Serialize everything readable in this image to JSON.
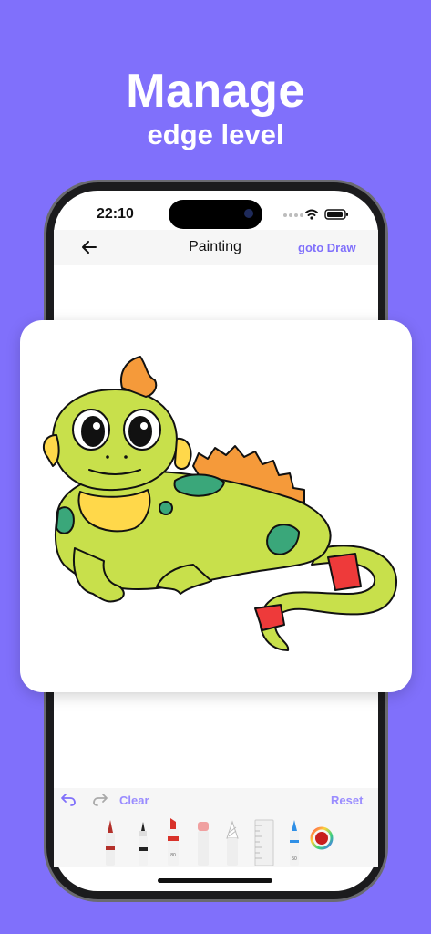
{
  "promo": {
    "headline": "Manage",
    "subheadline": "edge level"
  },
  "status_bar": {
    "time": "22:10"
  },
  "nav": {
    "title": "Painting",
    "goto": "goto Draw",
    "back_icon": "arrow-left-icon"
  },
  "toolbar": {
    "clear": "Clear",
    "reset": "Reset",
    "undo_icon": "undo-icon",
    "redo_icon": "redo-icon"
  },
  "tools": [
    {
      "name": "brush",
      "color": "#b3302a"
    },
    {
      "name": "fineliner",
      "color": "#222222"
    },
    {
      "name": "marker",
      "color": "#d8322a",
      "size": "80"
    },
    {
      "name": "eraser",
      "color": "#f0a0a0"
    },
    {
      "name": "pencil",
      "color": "#bbbbbb"
    },
    {
      "name": "ruler",
      "color": "#e8e8e8"
    },
    {
      "name": "pen",
      "color": "#2f8fe6",
      "size": "50"
    },
    {
      "name": "color-picker",
      "color": "#c81e1e"
    }
  ],
  "colors": {
    "accent": "#8070fb",
    "background": "#8070fb"
  }
}
